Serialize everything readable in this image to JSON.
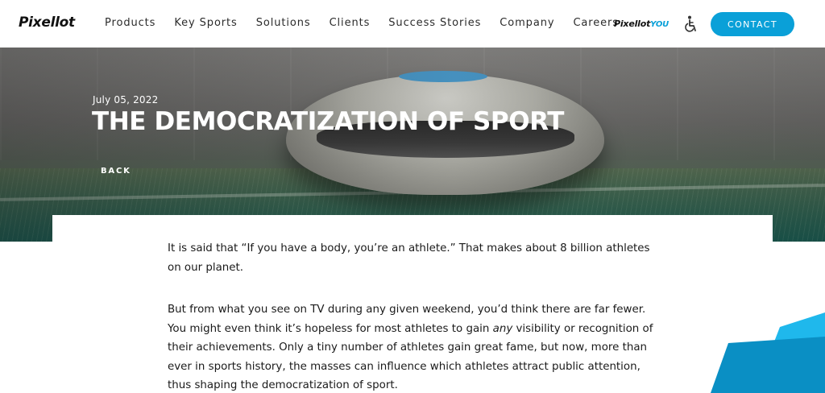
{
  "header": {
    "logo_text": "Pixellot",
    "nav": [
      {
        "label": "Products"
      },
      {
        "label": "Key Sports"
      },
      {
        "label": "Solutions"
      },
      {
        "label": "Clients"
      },
      {
        "label": "Success Stories"
      },
      {
        "label": "Company"
      },
      {
        "label": "Careers"
      }
    ],
    "you_logo_main": "Pixellot",
    "you_logo_suffix": "YOU",
    "accessibility_icon": "wheelchair-icon",
    "contact_label": "CONTACT"
  },
  "hero": {
    "date": "July 05, 2022",
    "title": "THE DEMOCRATIZATION OF SPORT",
    "back_label": "BACK"
  },
  "article": {
    "paragraph_1": "It is said that “If you have a body, you’re an athlete.” That makes about 8 billion athletes on our planet.",
    "paragraph_2_before": "But from what you see on TV during any given weekend, you’d think there are far fewer. You might even think it’s hopeless for most athletes to gain ",
    "paragraph_2_emphasis": "any",
    "paragraph_2_after": " visibility or recognition of their achievements. Only a tiny number of athletes gain great fame, but now, more than ever in sports history, the masses can influence which athletes attract public attention, thus shaping the democratization of sport."
  },
  "colors": {
    "accent": "#0aa0d8",
    "deco_light": "#1fb8ec",
    "deco_dark": "#0a8fc4"
  }
}
